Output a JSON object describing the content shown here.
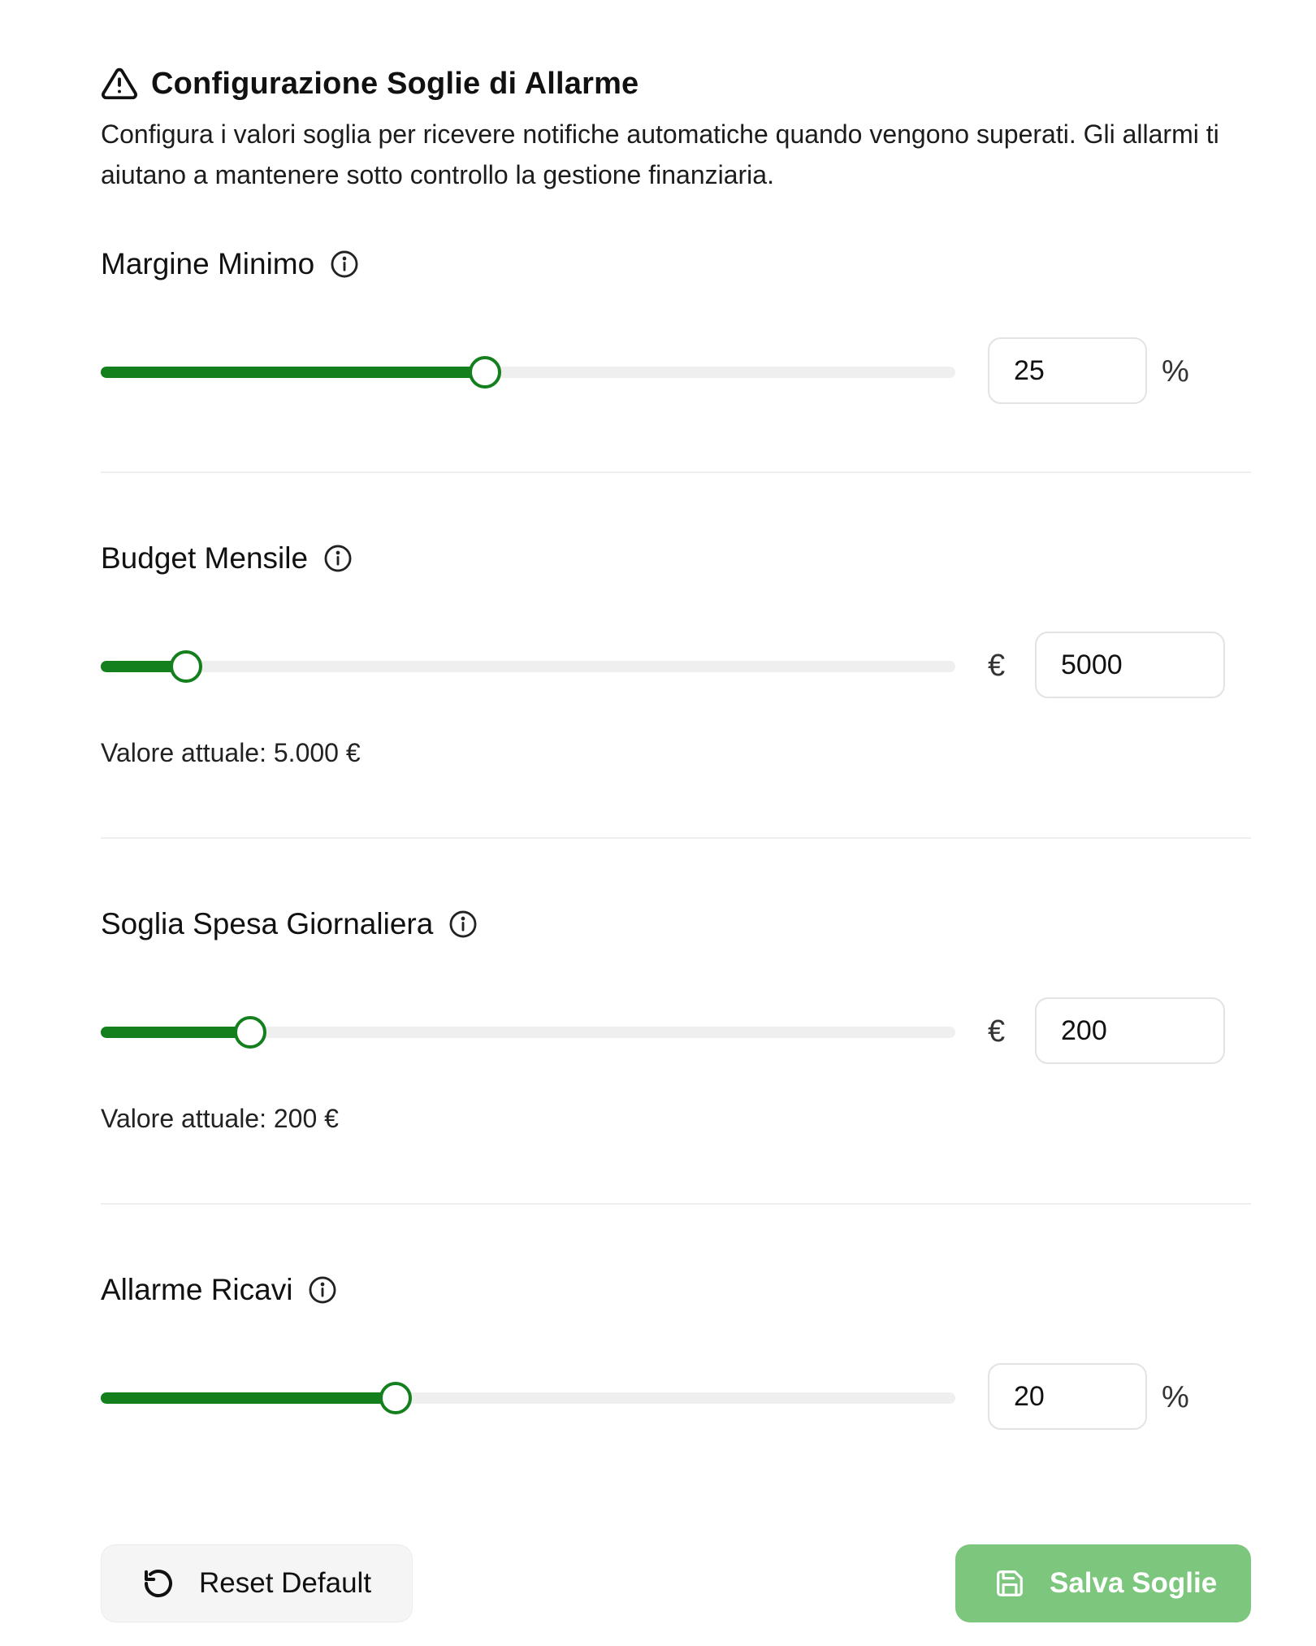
{
  "header": {
    "title": "Configurazione Soglie di Allarme",
    "icon": "alert-triangle-icon",
    "description": "Configura i valori soglia per ricevere notifiche automatiche quando vengono superati. Gli allarmi ti aiutano a mantenere sotto controllo la gestione finanziaria."
  },
  "settings": [
    {
      "label": "Margine Minimo",
      "info_icon": "info-icon",
      "value": "25",
      "unit": "%",
      "slider_fraction": 0.45
    },
    {
      "label": "Budget Mensile",
      "info_icon": "info-icon",
      "value": "5000",
      "unit": "€",
      "slider_fraction": 0.1,
      "current_value_text": "Valore attuale: 5.000 €"
    },
    {
      "label": "Soglia Spesa Giornaliera",
      "info_icon": "info-icon",
      "value": "200",
      "unit": "€",
      "slider_fraction": 0.175,
      "current_value_text": "Valore attuale: 200 €"
    },
    {
      "label": "Allarme Ricavi",
      "info_icon": "info-icon",
      "value": "20",
      "unit": "%",
      "slider_fraction": 0.345
    }
  ],
  "actions": {
    "reset_label": "Reset Default",
    "reset_icon": "rotate-ccw-icon",
    "save_label": "Salva Soglie",
    "save_icon": "save-icon"
  },
  "colors": {
    "accent": "#137f1d",
    "track": "#efefef",
    "save_button": "#7cc67d",
    "reset_button": "#f5f5f6"
  }
}
